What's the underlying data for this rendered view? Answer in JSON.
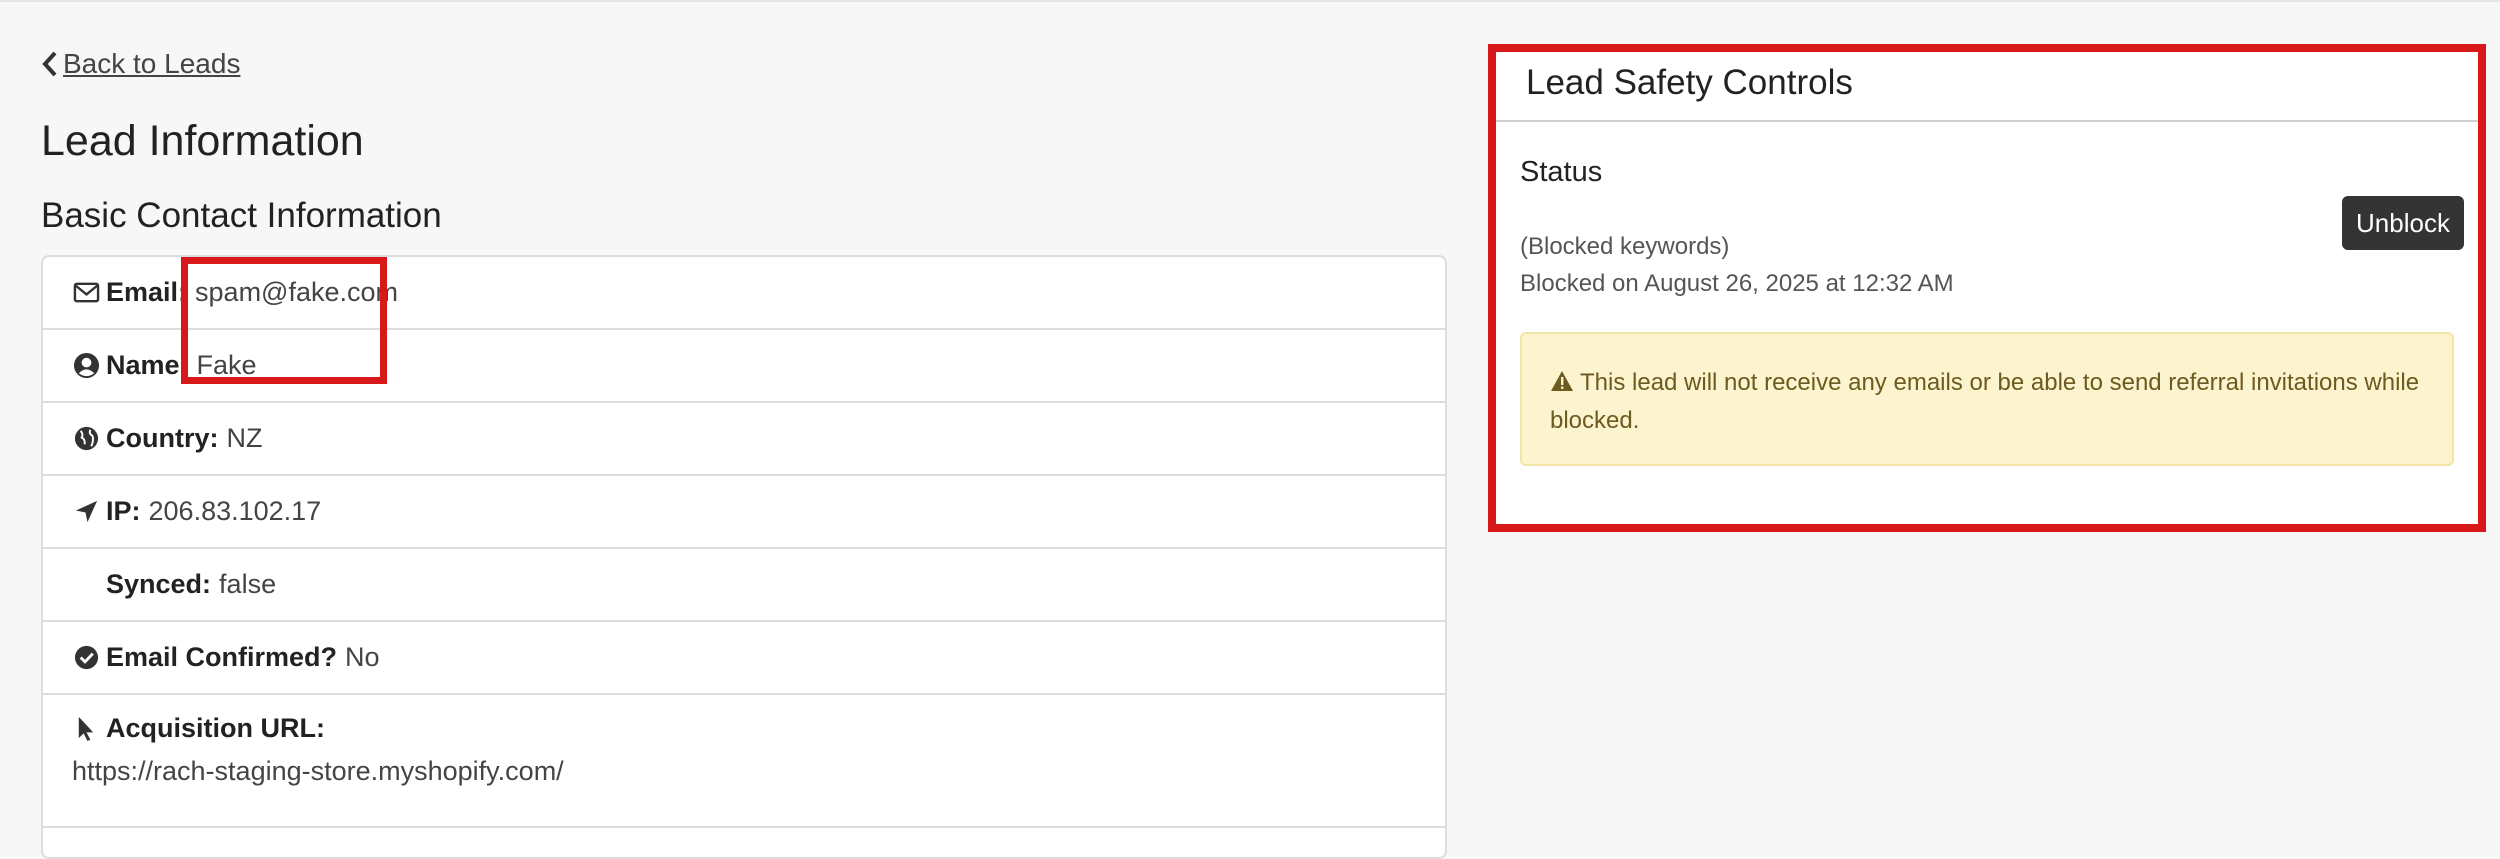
{
  "nav": {
    "back_label": "Back to Leads"
  },
  "page": {
    "title": "Lead Information",
    "section_title": "Basic Contact Information"
  },
  "contact": {
    "email_label": "Email:",
    "email_value": "spam@fake.com",
    "name_label": "Name:",
    "name_value": "Fake",
    "country_label": "Country:",
    "country_value": "NZ",
    "ip_label": "IP:",
    "ip_value": "206.83.102.17",
    "synced_label": "Synced:",
    "synced_value": "false",
    "confirmed_label": "Email Confirmed?",
    "confirmed_value": "No",
    "acq_label": "Acquisition URL:",
    "acq_value": "https://rach-staging-store.myshopify.com/"
  },
  "safety": {
    "title": "Lead Safety Controls",
    "status_label": "Status",
    "unblock_label": "Unblock",
    "reason": "(Blocked keywords)",
    "blocked_on": "Blocked on August 26, 2025 at 12:32 AM",
    "warning": "This lead will not receive any emails or be able to send referral invitations while blocked."
  },
  "colors": {
    "highlight": "#d7191c",
    "button_bg": "#343434",
    "warning_bg": "#fcf3cf",
    "warning_text": "#6d5a1e"
  },
  "icons": [
    "chevron-left-icon",
    "envelope-icon",
    "user-circle-icon",
    "globe-icon",
    "location-arrow-icon",
    "check-circle-icon",
    "mouse-pointer-icon",
    "warning-triangle-icon"
  ]
}
